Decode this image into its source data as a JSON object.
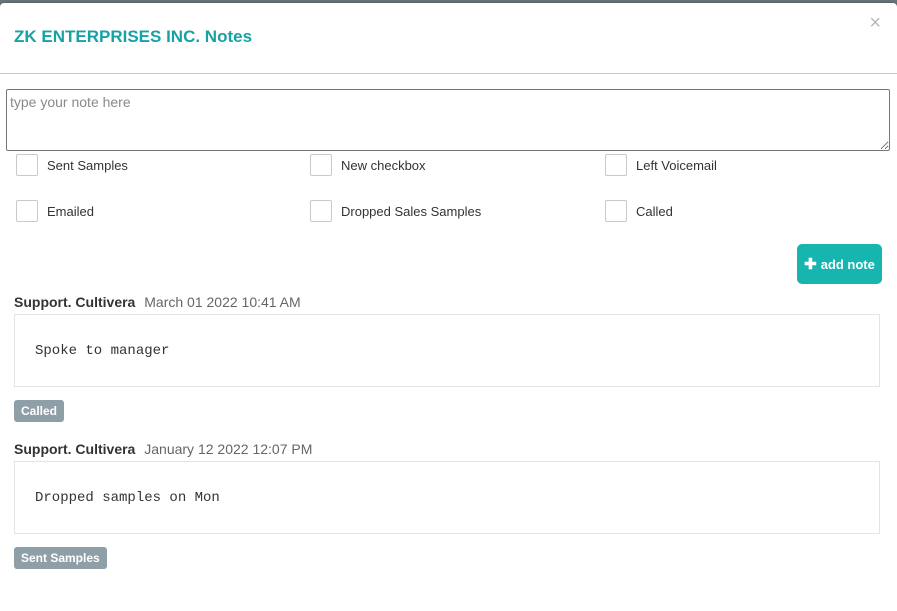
{
  "modal": {
    "title": "ZK ENTERPRISES INC. Notes",
    "close_glyph": "×"
  },
  "note_input": {
    "placeholder": "type your note here",
    "value": ""
  },
  "checkboxes": [
    {
      "label": "Sent Samples",
      "checked": false
    },
    {
      "label": "New checkbox",
      "checked": false
    },
    {
      "label": "Left Voicemail",
      "checked": false
    },
    {
      "label": "Emailed",
      "checked": false
    },
    {
      "label": "Dropped Sales Samples",
      "checked": false
    },
    {
      "label": "Called",
      "checked": false
    }
  ],
  "add_button": {
    "icon": "plus-icon",
    "label": "add note",
    "color": "#17b5b0"
  },
  "notes": [
    {
      "author": "Support. Cultivera",
      "date": "March 01 2022 10:41 AM",
      "text": "Spoke to manager",
      "tag": "Called"
    },
    {
      "author": "Support. Cultivera",
      "date": "January 12 2022 12:07 PM",
      "text": "Dropped samples on Mon",
      "tag": "Sent Samples"
    }
  ],
  "colors": {
    "accent": "#17a2a5",
    "button": "#17b5b0",
    "tag": "#8f9fa7"
  }
}
